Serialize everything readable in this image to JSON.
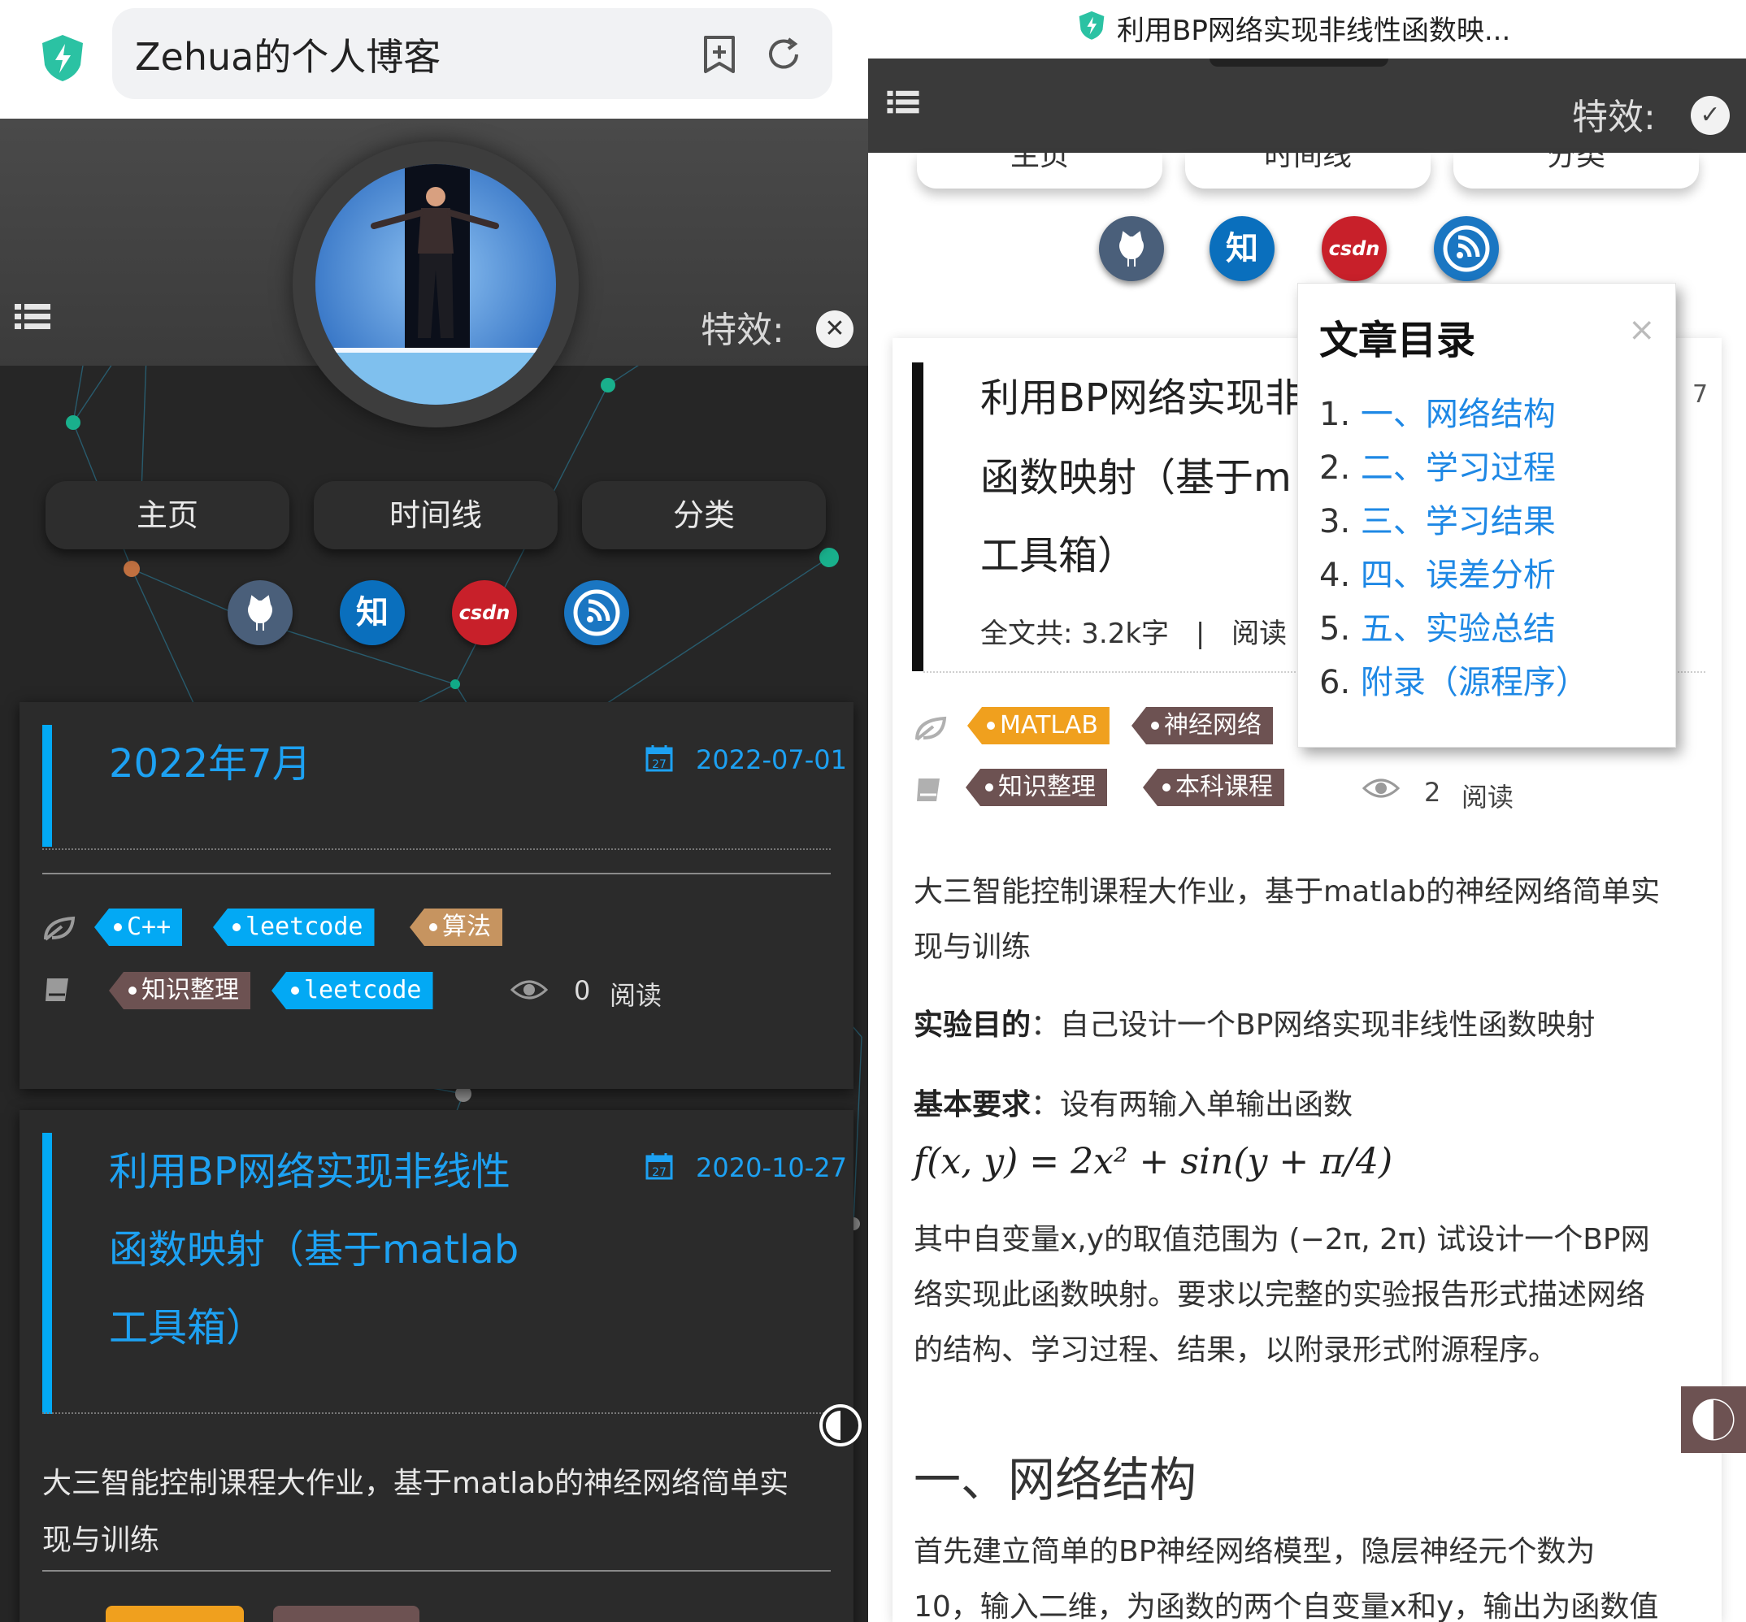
{
  "left": {
    "browser": {
      "site_title": "Zehua的个人博客"
    },
    "header": {
      "effects_label": "特效:",
      "effects_toggle": "✕"
    },
    "nav": [
      "主页",
      "时间线",
      "分类"
    ],
    "social": [
      {
        "name": "github",
        "label": "",
        "color": "#4a5f7a"
      },
      {
        "name": "zhihu",
        "label": "知",
        "color": "#0a6fbd"
      },
      {
        "name": "csdn",
        "label": "csdn",
        "color": "#c8202a"
      },
      {
        "name": "rss",
        "label": "",
        "color": "#1a76c2"
      }
    ],
    "posts": [
      {
        "title_lines": [
          "2022年7月"
        ],
        "date": "2022-07-01",
        "calendar_day": "27",
        "tags": [
          {
            "text": "C++",
            "color": "#03a9f4",
            "mono": true
          },
          {
            "text": "leetcode",
            "color": "#03a9f4",
            "mono": true
          },
          {
            "text": "算法",
            "color": "#c69460",
            "mono": false
          }
        ],
        "categories": [
          {
            "text": "知识整理",
            "color": "#6d5252",
            "mono": false
          },
          {
            "text": "leetcode",
            "color": "#03a9f4",
            "mono": true
          }
        ],
        "views": "0",
        "views_label": "阅读"
      },
      {
        "title_lines": [
          "利用BP网络实现非线性",
          "函数映射（基于matlab",
          "工具箱）"
        ],
        "date": "2020-10-27",
        "calendar_day": "27",
        "excerpt_lines": [
          "大三智能控制课程大作业，基于matlab的神经网络简单实",
          "现与训练"
        ]
      }
    ]
  },
  "right": {
    "browser": {
      "page_title": "利用BP网络实现非线性函数映..."
    },
    "header": {
      "effects_label": "特效:",
      "effects_toggle": "✓"
    },
    "nav": [
      "主页",
      "时间线",
      "分类"
    ],
    "social": [
      {
        "name": "github",
        "label": "",
        "color": "#4a5f7a"
      },
      {
        "name": "zhihu",
        "label": "知",
        "color": "#0a6fbd"
      },
      {
        "name": "csdn",
        "label": "csdn",
        "color": "#c8202a"
      },
      {
        "name": "rss",
        "label": "",
        "color": "#1a76c2"
      }
    ],
    "article": {
      "title_lines": [
        "利用BP网络实现非",
        "函数映射（基于m",
        "工具箱）"
      ],
      "date_fragment": "7",
      "word_count": "全文共: 3.2k字",
      "separator": "|",
      "read_label": "阅读",
      "tags": [
        {
          "text": "MATLAB",
          "color": "#f0a01e"
        },
        {
          "text": "神经网络",
          "color": "#6d5252"
        }
      ],
      "categories": [
        {
          "text": "知识整理",
          "color": "#6d5252"
        },
        {
          "text": "本科课程",
          "color": "#6d5252"
        }
      ],
      "views": "2",
      "views_label": "阅读",
      "summary_lines": [
        "大三智能控制课程大作业，基于matlab的神经网络简单实",
        "现与训练"
      ],
      "purpose_label": "实验目的",
      "purpose_text": "：自己设计一个BP网络实现非线性函数映射",
      "req_label": "基本要求",
      "req_text": "：设有两输入单输出函数",
      "formula": "f(x, y) = 2x² + sin(y + π/4)",
      "range_lines": [
        "其中自变量x,y的取值范围为 (−2π, 2π) 试设计一个BP网",
        "络实现此函数映射。要求以完整的实验报告形式描述网络",
        "的结构、学习过程、结果，以附录形式附源程序。"
      ],
      "section_heading": "一、网络结构",
      "section_lines": [
        "首先建立简单的BP神经网络模型，隐层神经元个数为",
        "10，输入二维，为函数的两个自变量x和y，输出为函数值"
      ]
    },
    "toc": {
      "title": "文章目录",
      "close": "×",
      "items": [
        {
          "num": "1.",
          "text": "一、网络结构"
        },
        {
          "num": "2.",
          "text": "二、学习过程"
        },
        {
          "num": "3.",
          "text": "三、学习结果"
        },
        {
          "num": "4.",
          "text": "四、误差分析"
        },
        {
          "num": "5.",
          "text": "五、实验总结"
        },
        {
          "num": "6.",
          "text": "附录（源程序）"
        }
      ]
    }
  }
}
